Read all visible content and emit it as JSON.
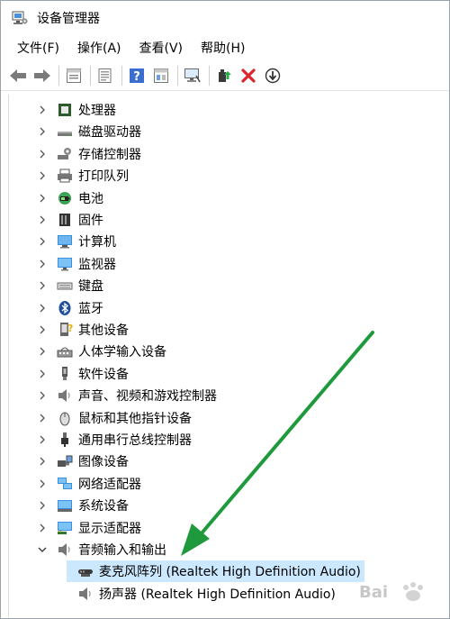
{
  "window": {
    "title": "设备管理器"
  },
  "menu": [
    "文件(F)",
    "操作(A)",
    "查看(V)",
    "帮助(H)"
  ],
  "toolbar": [
    {
      "name": "back-arrow-icon"
    },
    {
      "name": "forward-arrow-icon"
    },
    {
      "name": "properties-icon"
    },
    {
      "name": "update-driver-icon"
    },
    {
      "name": "help-icon"
    },
    {
      "name": "view-panel-icon"
    },
    {
      "name": "scan-hardware-icon"
    },
    {
      "name": "add-driver-icon"
    },
    {
      "name": "uninstall-icon"
    },
    {
      "name": "disable-device-icon"
    }
  ],
  "tree": {
    "categories": [
      {
        "label": "处理器",
        "icon": "processor-icon"
      },
      {
        "label": "磁盘驱动器",
        "icon": "disk-drive-icon"
      },
      {
        "label": "存储控制器",
        "icon": "storage-controller-icon"
      },
      {
        "label": "打印队列",
        "icon": "printer-icon"
      },
      {
        "label": "电池",
        "icon": "battery-icon"
      },
      {
        "label": "固件",
        "icon": "firmware-icon"
      },
      {
        "label": "计算机",
        "icon": "computer-icon"
      },
      {
        "label": "监视器",
        "icon": "monitor-icon"
      },
      {
        "label": "键盘",
        "icon": "keyboard-icon"
      },
      {
        "label": "蓝牙",
        "icon": "bluetooth-icon"
      },
      {
        "label": "其他设备",
        "icon": "other-device-icon"
      },
      {
        "label": "人体学输入设备",
        "icon": "hid-icon"
      },
      {
        "label": "软件设备",
        "icon": "software-device-icon"
      },
      {
        "label": "声音、视频和游戏控制器",
        "icon": "speaker-icon"
      },
      {
        "label": "鼠标和其他指针设备",
        "icon": "mouse-icon"
      },
      {
        "label": "通用串行总线控制器",
        "icon": "usb-icon"
      },
      {
        "label": "图像设备",
        "icon": "camera-icon"
      },
      {
        "label": "网络适配器",
        "icon": "network-adapter-icon"
      },
      {
        "label": "系统设备",
        "icon": "system-device-icon"
      },
      {
        "label": "显示适配器",
        "icon": "display-adapter-icon"
      },
      {
        "label": "音频输入和输出",
        "icon": "audio-io-icon",
        "expanded": true
      }
    ],
    "children": [
      {
        "label": "麦克风阵列 (Realtek High Definition Audio)",
        "icon": "microphone-icon",
        "selected": true
      },
      {
        "label": "扬声器 (Realtek High Definition Audio)",
        "icon": "speaker-icon"
      }
    ]
  },
  "colors": {
    "selection": "#cce8ff",
    "arrow": "#1e9a3c",
    "delete": "#e0242c"
  },
  "watermark": {
    "text": "Bai"
  }
}
